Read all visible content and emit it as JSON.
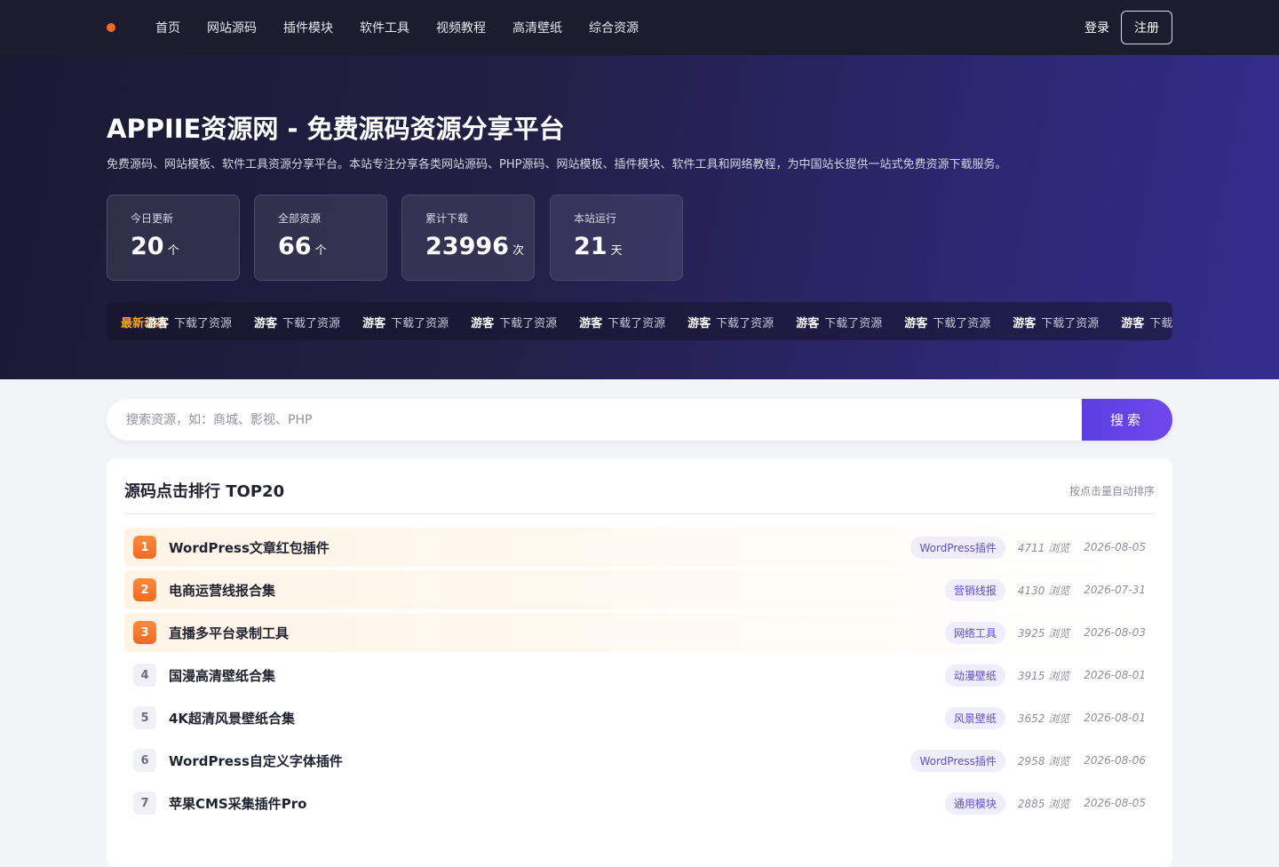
{
  "nav": {
    "items": [
      "首页",
      "网站源码",
      "插件模块",
      "软件工具",
      "视频教程",
      "高清壁纸",
      "综合资源"
    ],
    "login": "登录",
    "register": "注册"
  },
  "hero": {
    "title": "APPIIE资源网 - 免费源码资源分享平台",
    "subtitle": "免费源码、网站模板、软件工具资源分享平台。本站专注分享各类网站源码、PHP源码、网站模板、插件模块、软件工具和网络教程，为中国站长提供一站式免费资源下载服务。",
    "stats": [
      {
        "label": "今日更新",
        "value": "20",
        "unit": "个"
      },
      {
        "label": "全部资源",
        "value": "66",
        "unit": "个"
      },
      {
        "label": "累计下载",
        "value": "23996",
        "unit": "次"
      },
      {
        "label": "本站运行",
        "value": "21",
        "unit": "天"
      }
    ],
    "ticker": {
      "label": "最新动态",
      "items": [
        {
          "user": "游客",
          "action": "下载了资源"
        },
        {
          "user": "游客",
          "action": "下载了资源"
        },
        {
          "user": "游客",
          "action": "下载了资源"
        },
        {
          "user": "游客",
          "action": "下载了资源"
        },
        {
          "user": "游客",
          "action": "下载了资源"
        },
        {
          "user": "游客",
          "action": "下载了资源"
        },
        {
          "user": "游客",
          "action": "下载了资源"
        },
        {
          "user": "游客",
          "action": "下载了资源"
        },
        {
          "user": "游客",
          "action": "下载了资源"
        },
        {
          "user": "游客",
          "action": "下载了资源"
        }
      ]
    }
  },
  "search": {
    "placeholder": "搜索资源，如：商城、影视、PHP",
    "button": "搜索"
  },
  "ranking": {
    "title": "源码点击排行 TOP20",
    "note": "按点击量自动排序",
    "items": [
      {
        "rank": "1",
        "title": "WordPress文章红包插件",
        "tag": "WordPress插件",
        "views": "4711 浏览",
        "date": "2026-08-05",
        "hot": true
      },
      {
        "rank": "2",
        "title": "电商运营线报合集",
        "tag": "营销线报",
        "views": "4130 浏览",
        "date": "2026-07-31",
        "hot": true
      },
      {
        "rank": "3",
        "title": "直播多平台录制工具",
        "tag": "网络工具",
        "views": "3925 浏览",
        "date": "2026-08-03",
        "hot": true
      },
      {
        "rank": "4",
        "title": "国漫高清壁纸合集",
        "tag": "动漫壁纸",
        "views": "3915 浏览",
        "date": "2026-08-01",
        "hot": false
      },
      {
        "rank": "5",
        "title": "4K超清风景壁纸合集",
        "tag": "风景壁纸",
        "views": "3652 浏览",
        "date": "2026-08-01",
        "hot": false
      },
      {
        "rank": "6",
        "title": "WordPress自定义字体插件",
        "tag": "WordPress插件",
        "views": "2958 浏览",
        "date": "2026-08-06",
        "hot": false
      },
      {
        "rank": "7",
        "title": "苹果CMS采集插件Pro",
        "tag": "通用模块",
        "views": "2885 浏览",
        "date": "2026-08-05",
        "hot": false
      }
    ]
  },
  "colors": {
    "nav_bg": "#1b1c2e",
    "accent": "#6a45ea",
    "hot_rank": "#f26a21",
    "ticker_label": "#f7a61a"
  }
}
